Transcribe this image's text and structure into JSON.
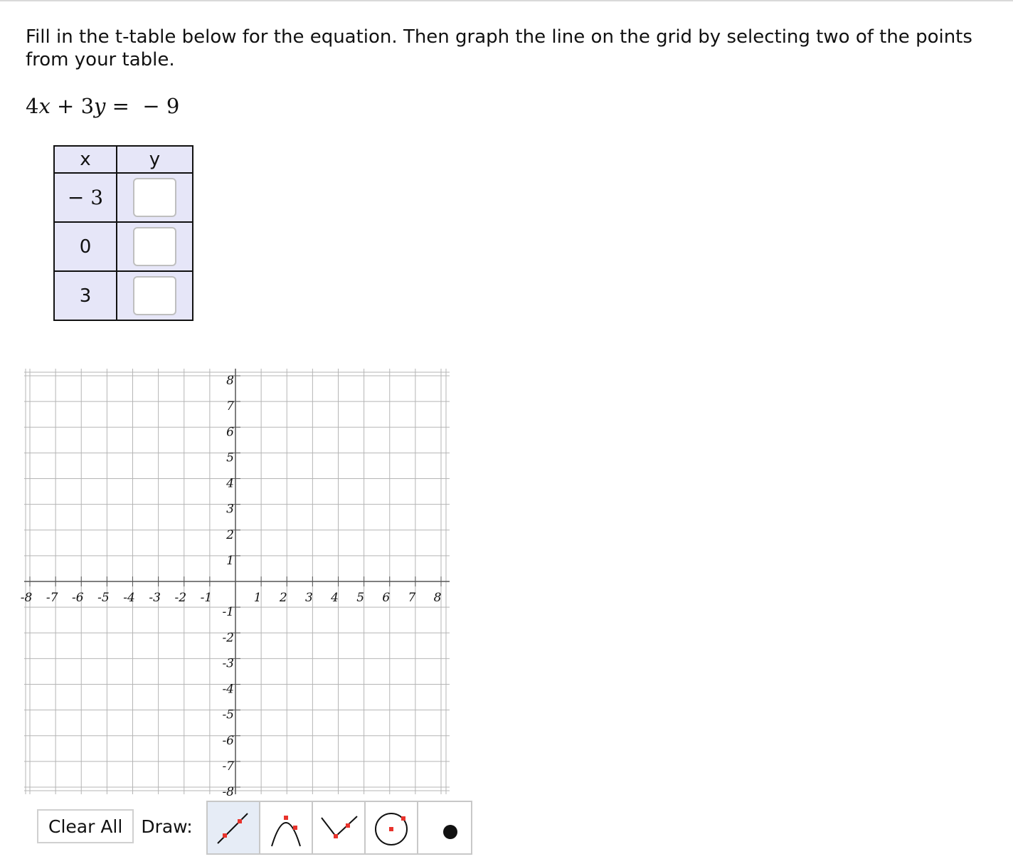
{
  "instructions": "Fill in the t-table below for the equation. Then graph the line on the grid by selecting two of the points from your table.",
  "equation": {
    "coef_x": "4",
    "var_x": "x",
    "plus": "+",
    "coef_y": "3",
    "var_y": "y",
    "equals": "=",
    "rhs": "− 9"
  },
  "table": {
    "header_x": "x",
    "header_y": "y",
    "rows": [
      {
        "x": "− 3",
        "y": ""
      },
      {
        "x": "0",
        "y": ""
      },
      {
        "x": "3",
        "y": ""
      }
    ],
    "header_bg": "#e6e6f8"
  },
  "graph": {
    "x_ticks": [
      "-8",
      "-7",
      "-6",
      "-5",
      "-4",
      "-3",
      "-2",
      "-1",
      "1",
      "2",
      "3",
      "4",
      "5",
      "6",
      "7",
      "8"
    ],
    "y_ticks": [
      "8",
      "7",
      "6",
      "5",
      "4",
      "3",
      "2",
      "1",
      "-1",
      "-2",
      "-3",
      "-4",
      "-5",
      "-6",
      "-7",
      "-8"
    ],
    "xlim": [
      -8,
      8
    ],
    "ylim": [
      -8,
      8
    ],
    "grid": true,
    "grid_color": "#b5b5b5",
    "axis_color": "#555555"
  },
  "toolbar": {
    "clear_label": "Clear All",
    "draw_label": "Draw:",
    "tools": [
      {
        "icon": "line-icon",
        "selected": true
      },
      {
        "icon": "parabola-icon",
        "selected": false
      },
      {
        "icon": "absolute-value-icon",
        "selected": false
      },
      {
        "icon": "circle-icon",
        "selected": false
      },
      {
        "icon": "point-icon",
        "selected": false
      }
    ],
    "marker_color": "#e8332c",
    "selected_bg": "#e6ecf6"
  }
}
